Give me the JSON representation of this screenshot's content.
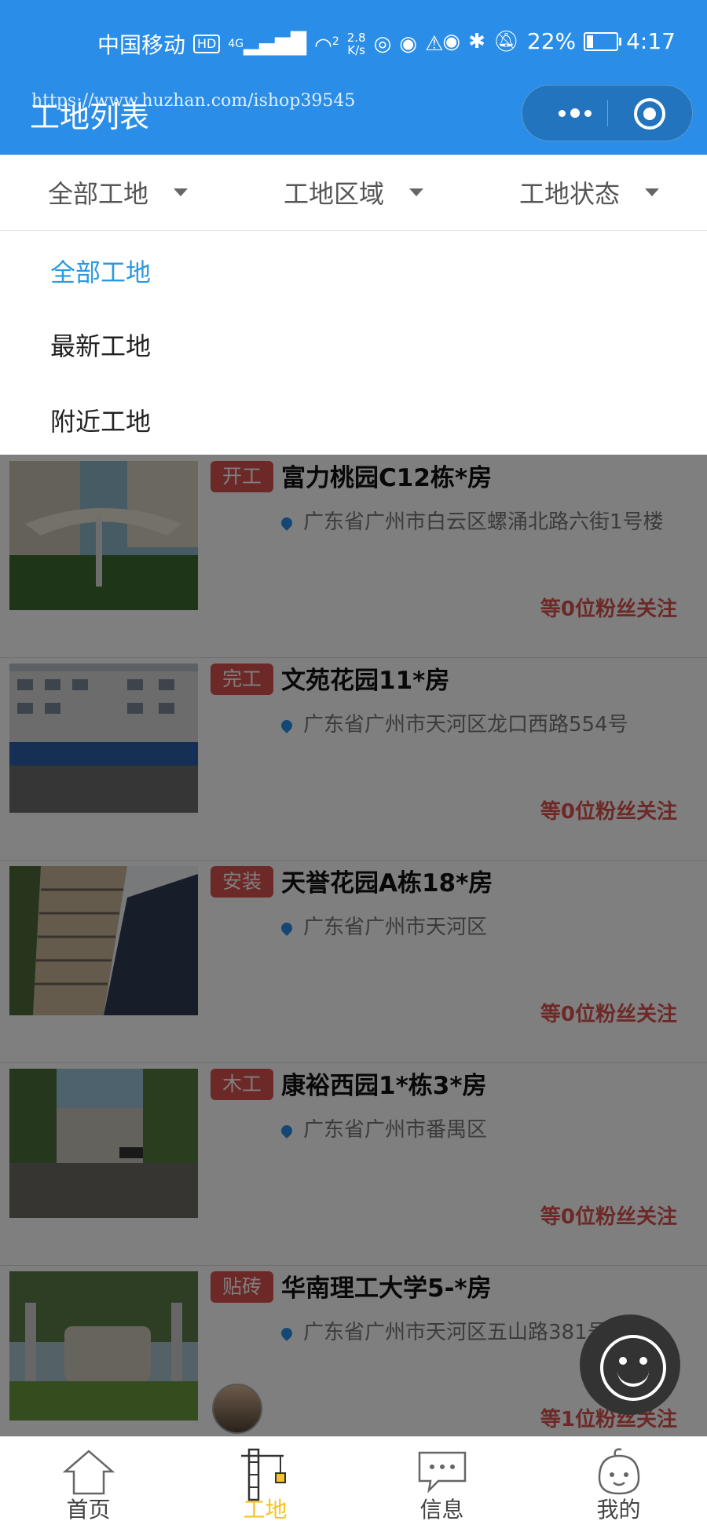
{
  "status_bar": {
    "carrier": "中国移动",
    "hd": "HD",
    "net": "4G",
    "wifi_sub": "2",
    "speed_value": "2.8",
    "speed_unit": "K/s",
    "battery": "22%",
    "battery_level": 0.22,
    "time": "4:17"
  },
  "header": {
    "title": "工地列表",
    "watermark": "https://www.huzhan.com/ishop39545"
  },
  "filters": [
    {
      "label": "全部工地"
    },
    {
      "label": "工地区域"
    },
    {
      "label": "工地状态"
    }
  ],
  "dropdown": {
    "items": [
      {
        "label": "全部工地",
        "active": true
      },
      {
        "label": "最新工地",
        "active": false
      },
      {
        "label": "附近工地",
        "active": false
      }
    ]
  },
  "sites": [
    {
      "tag": "开工",
      "title": "富力桃园C12栋*房",
      "address": "广东省广州市白云区螺涌北路六街1号楼",
      "fans": "等0位粉丝关注"
    },
    {
      "tag": "完工",
      "title": "文苑花园11*房",
      "address": "广东省广州市天河区龙口西路554号",
      "fans": "等0位粉丝关注"
    },
    {
      "tag": "安装",
      "title": "天誉花园A栋18*房",
      "address": "广东省广州市天河区",
      "fans": "等0位粉丝关注"
    },
    {
      "tag": "木工",
      "title": "康裕西园1*栋3*房",
      "address": "广东省广州市番禺区",
      "fans": "等0位粉丝关注"
    },
    {
      "tag": "贴砖",
      "title": "华南理工大学5-*房",
      "address": "广东省广州市天河区五山路381号",
      "fans": "等1位粉丝关注"
    }
  ],
  "tabbar": [
    {
      "label": "首页",
      "icon": "home-icon",
      "active": false
    },
    {
      "label": "工地",
      "icon": "crane-icon",
      "active": true
    },
    {
      "label": "信息",
      "icon": "chat-icon",
      "active": false
    },
    {
      "label": "我的",
      "icon": "face-icon",
      "active": false
    }
  ],
  "colors": {
    "header_bg": "#2a8ee8",
    "tag_bg": "#d9534f",
    "dropdown_active": "#2a9ae0",
    "tab_active": "#f6c224"
  }
}
